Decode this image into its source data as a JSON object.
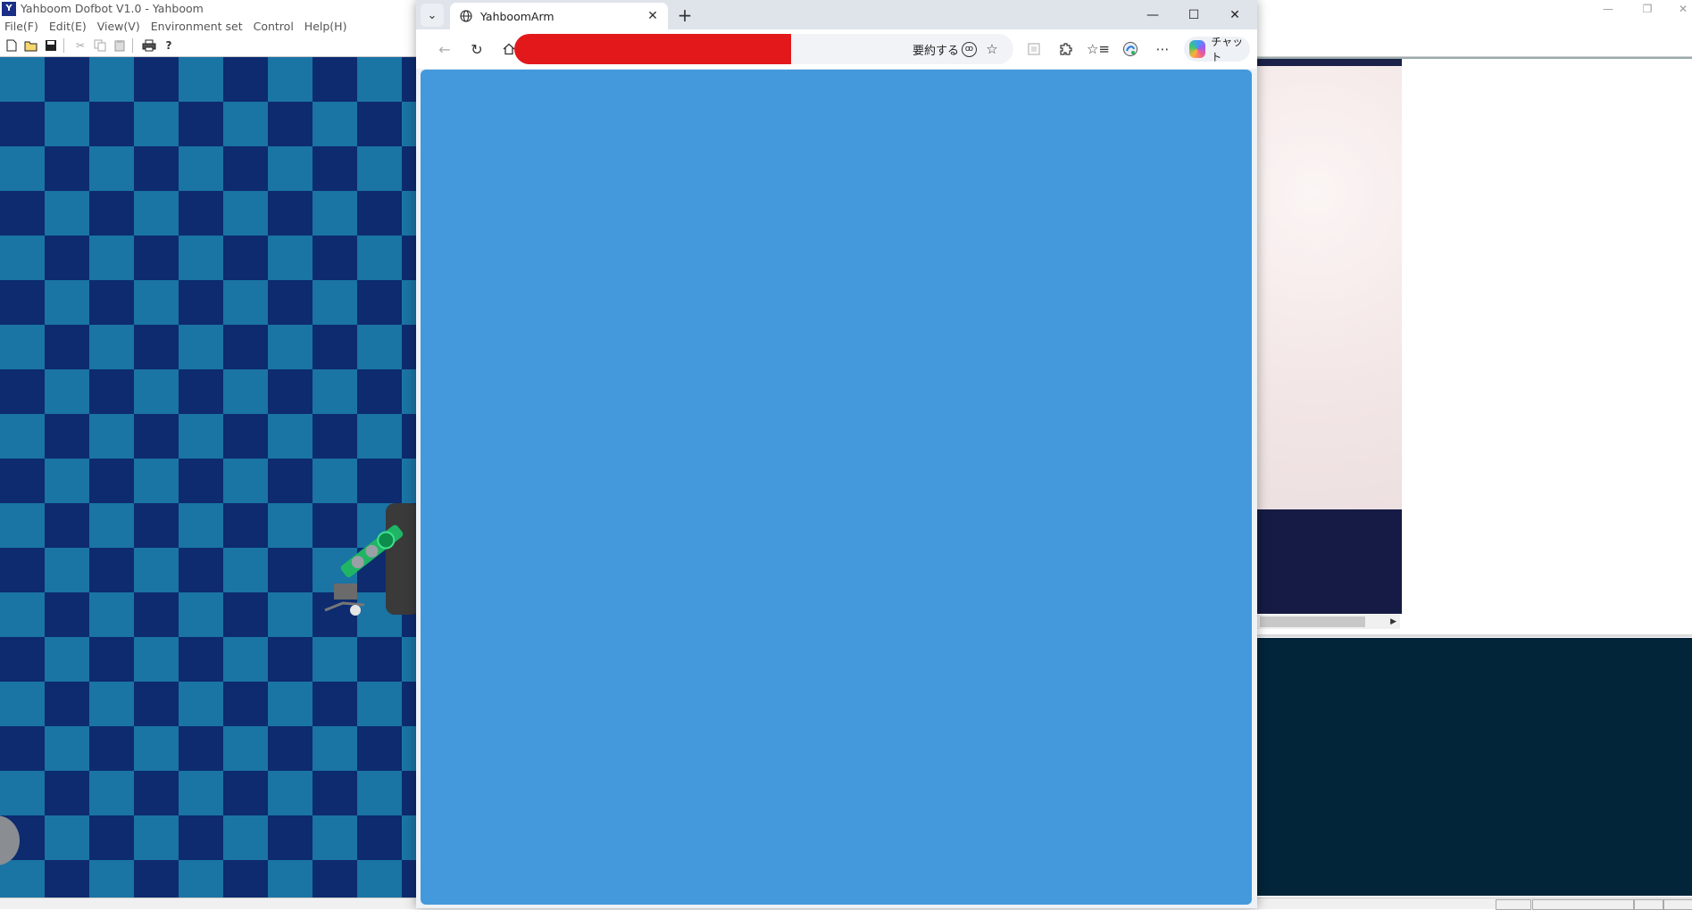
{
  "background_app": {
    "title": "Yahboom Dofbot V1.0 - Yahboom",
    "title_icon": "yahboom-logo-icon",
    "menu": [
      "File(F)",
      "Edit(E)",
      "View(V)",
      "Environment set",
      "Control",
      "Help(H)"
    ],
    "toolbar_icons": [
      "new-file-icon",
      "open-folder-icon",
      "save-icon",
      "cut-icon",
      "copy-icon",
      "paste-icon",
      "print-icon",
      "help-icon"
    ],
    "viewport_colors": {
      "light": "#1a74a4",
      "dark": "#0d2b6e"
    },
    "console_color": "#02253a"
  },
  "browser": {
    "tab_title": "YahboomArm",
    "summarize_label": "要約する",
    "chat_label": "チャット",
    "redaction_color": "#e3181b",
    "page_background": "#4499dd"
  }
}
